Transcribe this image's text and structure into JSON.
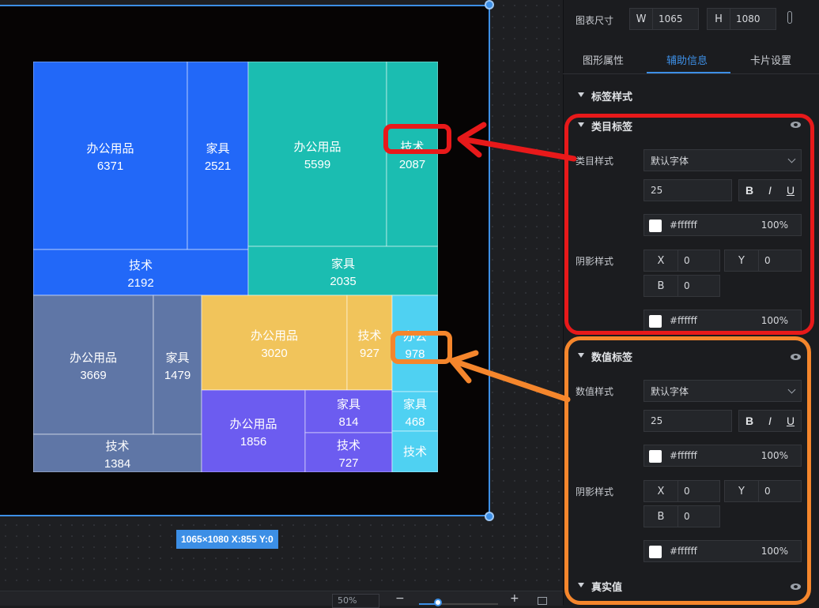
{
  "canvas": {
    "size_badge": "1065×1080   X:855 Y:0",
    "zoom_level": "50%"
  },
  "treemap": {
    "text_color": "#ffffff",
    "cells": [
      {
        "category": "办公用品",
        "value": "6371",
        "color": "#2268f8"
      },
      {
        "category": "家具",
        "value": "2521",
        "color": "#2268f8"
      },
      {
        "category": "技术",
        "value": "2192",
        "color": "#2268f8"
      },
      {
        "category": "办公用品",
        "value": "5599",
        "color": "#1bbdb1"
      },
      {
        "category": "技术",
        "value": "2087",
        "color": "#1bbdb1"
      },
      {
        "category": "家具",
        "value": "2035",
        "color": "#1bbdb1"
      },
      {
        "category": "办公用品",
        "value": "3669",
        "color": "#5f76a6"
      },
      {
        "category": "家具",
        "value": "1479",
        "color": "#5f76a6"
      },
      {
        "category": "技术",
        "value": "1384",
        "color": "#5f76a6"
      },
      {
        "category": "办公用品",
        "value": "3020",
        "color": "#f1c45b"
      },
      {
        "category": "技术",
        "value": "927",
        "color": "#f1c45b"
      },
      {
        "category": "办公用品",
        "value": "1856",
        "color": "#6c5cf0"
      },
      {
        "category": "家具",
        "value": "814",
        "color": "#6c5cf0"
      },
      {
        "category": "技术",
        "value": "727",
        "color": "#6c5cf0"
      },
      {
        "category": "办公",
        "value": "978",
        "color": "#4fd1f2"
      },
      {
        "category": "家具",
        "value": "468",
        "color": "#4fd1f2"
      },
      {
        "category": "技术",
        "value": "",
        "color": "#4fd1f2"
      }
    ]
  },
  "panel": {
    "chart_size_label": "图表尺寸",
    "width_prefix": "W",
    "width_value": "1065",
    "height_prefix": "H",
    "height_value": "1080",
    "tabs": [
      "图形属性",
      "辅助信息",
      "卡片设置"
    ],
    "active_tab": 1,
    "label_style_title": "标签样式",
    "category_label": {
      "title": "类目标签",
      "style_label": "类目样式",
      "font": "默认字体",
      "font_size": "25",
      "bold": "B",
      "italic": "I",
      "underline": "U",
      "color_hex": "#ffffff",
      "opacity": "100%",
      "shadow_label": "阴影样式",
      "shadow_x_prefix": "X",
      "shadow_x": "0",
      "shadow_y_prefix": "Y",
      "shadow_y": "0",
      "shadow_b_prefix": "B",
      "shadow_b": "0",
      "shadow_color_hex": "#ffffff",
      "shadow_opacity": "100%"
    },
    "value_label": {
      "title": "数值标签",
      "style_label": "数值样式",
      "font": "默认字体",
      "font_size": "25",
      "bold": "B",
      "italic": "I",
      "underline": "U",
      "color_hex": "#ffffff",
      "opacity": "100%",
      "shadow_label": "阴影样式",
      "shadow_x_prefix": "X",
      "shadow_x": "0",
      "shadow_y_prefix": "Y",
      "shadow_y": "0",
      "shadow_b_prefix": "B",
      "shadow_b": "0",
      "shadow_color_hex": "#ffffff",
      "shadow_opacity": "100%"
    },
    "real_value_title": "真实值"
  },
  "colors": {
    "accent": "#3d8fe6",
    "annotation_red": "#e8191a",
    "annotation_orange": "#f5862c"
  }
}
